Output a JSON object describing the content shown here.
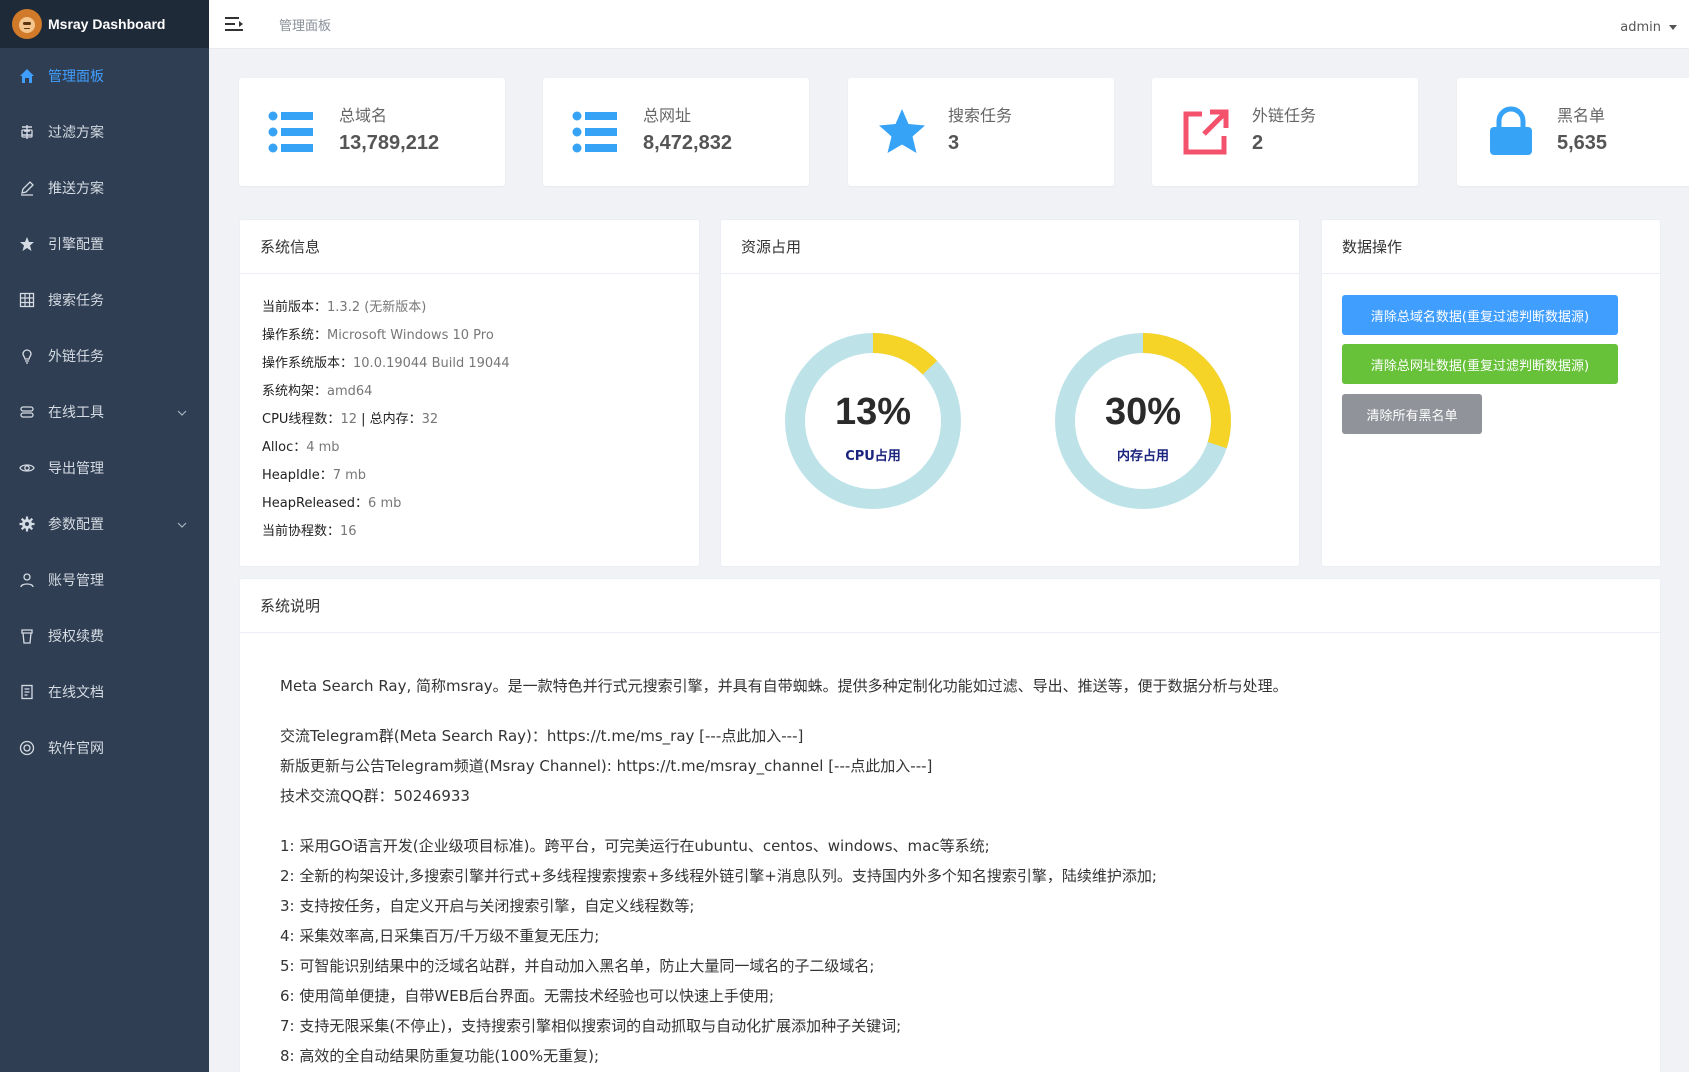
{
  "sidebar": {
    "brand": "Msray Dashboard",
    "items": [
      {
        "label": "管理面板",
        "icon": "home-icon",
        "active": true
      },
      {
        "label": "过滤方案",
        "icon": "filter-icon"
      },
      {
        "label": "推送方案",
        "icon": "edit-icon"
      },
      {
        "label": "引擎配置",
        "icon": "star-icon"
      },
      {
        "label": "搜索任务",
        "icon": "grid-icon"
      },
      {
        "label": "外链任务",
        "icon": "lightbulb-icon"
      },
      {
        "label": "在线工具",
        "icon": "tools-icon",
        "expandable": true
      },
      {
        "label": "导出管理",
        "icon": "eye-icon"
      },
      {
        "label": "参数配置",
        "icon": "gear-icon",
        "expandable": true
      },
      {
        "label": "账号管理",
        "icon": "user-icon"
      },
      {
        "label": "授权续费",
        "icon": "cup-icon"
      },
      {
        "label": "在线文档",
        "icon": "document-icon"
      },
      {
        "label": "软件官网",
        "icon": "lifebuoy-icon"
      }
    ]
  },
  "header": {
    "breadcrumb": "管理面板",
    "user": "admin"
  },
  "stats": [
    {
      "label": "总域名",
      "value": "13,789,212",
      "icon": "list-icon",
      "color": "#36a3f7"
    },
    {
      "label": "总网址",
      "value": "8,472,832",
      "icon": "list-icon",
      "color": "#36a3f7"
    },
    {
      "label": "搜索任务",
      "value": "3",
      "icon": "star-icon",
      "color": "#36a3f7"
    },
    {
      "label": "外链任务",
      "value": "2",
      "icon": "external-link-icon",
      "color": "#f4516c"
    },
    {
      "label": "黑名单",
      "value": "5,635",
      "icon": "lock-icon",
      "color": "#36a3f7"
    }
  ],
  "system_info": {
    "title": "系统信息",
    "rows": [
      {
        "key": "当前版本：",
        "value": "1.3.2 (无新版本)"
      },
      {
        "key": "操作系统：",
        "value": "Microsoft Windows 10 Pro"
      },
      {
        "key": "操作系统版本：",
        "value": "10.0.19044 Build 19044"
      },
      {
        "key": "系统构架：",
        "value": "amd64"
      },
      {
        "key": "CPU线程数：",
        "value": "12",
        "key2": " | 总内存：",
        "value2": "32"
      },
      {
        "key": "Alloc：",
        "value": "4 mb"
      },
      {
        "key": "HeapIdle：",
        "value": "7 mb"
      },
      {
        "key": "HeapReleased：",
        "value": "6 mb"
      },
      {
        "key": "当前协程数：",
        "value": "16"
      }
    ]
  },
  "resource": {
    "title": "资源占用",
    "track_color": "#bde3e9",
    "fill_color": "#f5d327",
    "gauges": [
      {
        "value": 13,
        "text": "13%",
        "label": "CPU占用"
      },
      {
        "value": 30,
        "text": "30%",
        "label": "内存占用"
      }
    ]
  },
  "data_ops": {
    "title": "数据操作",
    "buttons": [
      {
        "label": "清除总域名数据(重复过滤判断数据源)",
        "color": "#409eff"
      },
      {
        "label": "清除总网址数据(重复过滤判断数据源)",
        "color": "#67c23a"
      },
      {
        "label": "清除所有黑名单",
        "color": "#909399"
      }
    ]
  },
  "description": {
    "title": "系统说明",
    "intro": "Meta Search Ray, 简称msray。是一款特色并行式元搜索引擎，并具有自带蜘蛛。提供多种定制化功能如过滤、导出、推送等，便于数据分析与处理。",
    "contacts": [
      "交流Telegram群(Meta Search Ray)：https://t.me/ms_ray [---点此加入---]",
      "新版更新与公告Telegram频道(Msray Channel): https://t.me/msray_channel [---点此加入---]",
      "技术交流QQ群：50246933"
    ],
    "features": [
      "1: 采用GO语言开发(企业级项目标准)。跨平台，可完美运行在ubuntu、centos、windows、mac等系统;",
      "2: 全新的构架设计,多搜索引擎并行式+多线程搜索搜索+多线程外链引擎+消息队列。支持国内外多个知名搜索引擎，陆续维护添加;",
      "3: 支持按任务，自定义开启与关闭搜索引擎，自定义线程数等;",
      "4: 采集效率高,日采集百万/千万级不重复无压力;",
      "5: 可智能识别结果中的泛域名站群，并自动加入黑名单，防止大量同一域名的子二级域名;",
      "6: 使用简单便捷，自带WEB后台界面。无需技术经验也可以快速上手使用;",
      "7: 支持无限采集(不停止)，支持搜索引擎相似搜索词的自动抓取与自动化扩展添加种子关键词;",
      "8: 高效的全自动结果防重复功能(100%无重复);"
    ]
  }
}
